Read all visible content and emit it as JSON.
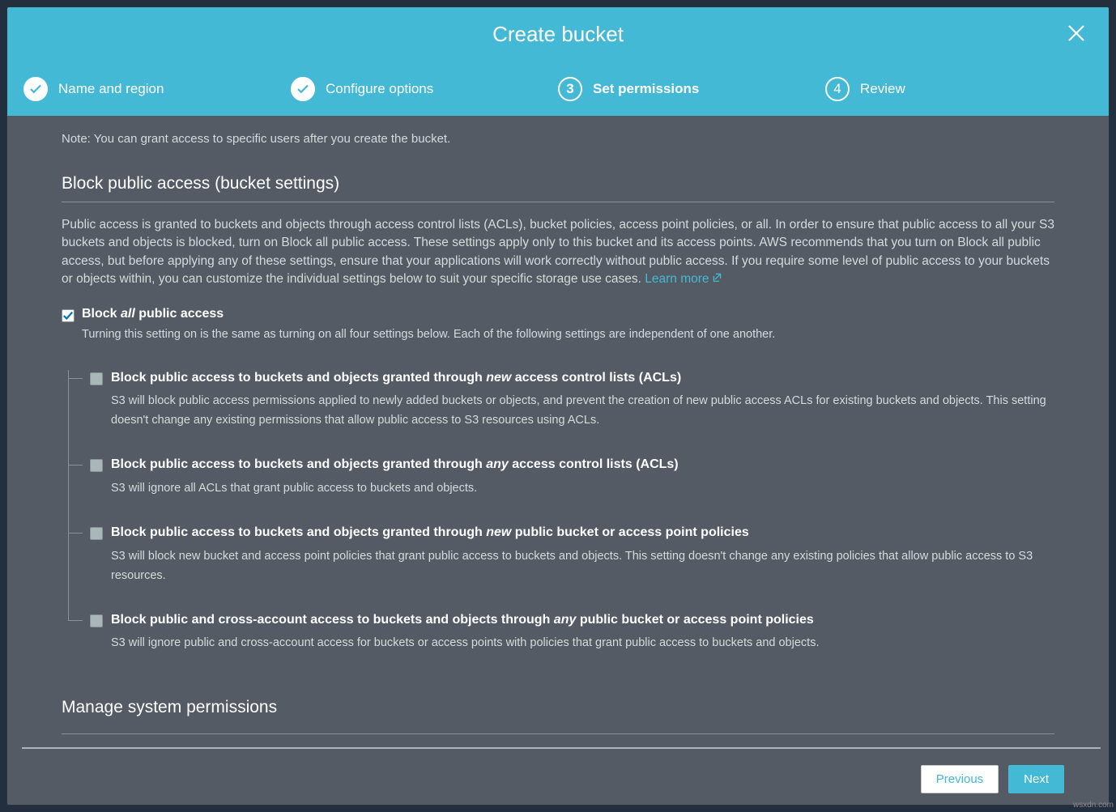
{
  "header": {
    "title": "Create bucket"
  },
  "steps": {
    "s1": "Name and region",
    "s2": "Configure options",
    "s3_num": "3",
    "s3": "Set permissions",
    "s4_num": "4",
    "s4": "Review"
  },
  "content": {
    "note": "Note: You can grant access to specific users after you create the bucket.",
    "section_title": "Block public access (bucket settings)",
    "section_desc": "Public access is granted to buckets and objects through access control lists (ACLs), bucket policies, access point policies, or all. In order to ensure that public access to all your S3 buckets and objects is blocked, turn on Block all public access. These settings apply only to this bucket and its access points. AWS recommends that you turn on Block all public access, but before applying any of these settings, ensure that your applications will work correctly without public access. If you require some level of public access to your buckets or objects within, you can customize the individual settings below to suit your specific storage use cases. ",
    "learn_more": "Learn more",
    "block_all_pre": "Block ",
    "block_all_em": "all",
    "block_all_post": " public access",
    "block_all_desc": "Turning this setting on is the same as turning on all four settings below. Each of the following settings are independent of one another.",
    "items": [
      {
        "label_pre": "Block public access to buckets and objects granted through ",
        "label_em": "new",
        "label_post": " access control lists (ACLs)",
        "desc": "S3 will block public access permissions applied to newly added buckets or objects, and prevent the creation of new public access ACLs for existing buckets and objects. This setting doesn't change any existing permissions that allow public access to S3 resources using ACLs."
      },
      {
        "label_pre": "Block public access to buckets and objects granted through ",
        "label_em": "any",
        "label_post": " access control lists (ACLs)",
        "desc": "S3 will ignore all ACLs that grant public access to buckets and objects."
      },
      {
        "label_pre": "Block public access to buckets and objects granted through ",
        "label_em": "new",
        "label_post": " public bucket or access point policies",
        "desc": "S3 will block new bucket and access point policies that grant public access to buckets and objects. This setting doesn't change any existing policies that allow public access to S3 resources."
      },
      {
        "label_pre": "Block public and cross-account access to buckets and objects through ",
        "label_em": "any",
        "label_post": " public bucket or access point policies",
        "desc": "S3 will ignore public and cross-account access for buckets or access points with policies that grant public access to buckets and objects."
      }
    ],
    "manage_title": "Manage system permissions"
  },
  "footer": {
    "previous": "Previous",
    "next": "Next"
  },
  "watermark": "wsxdn.com"
}
